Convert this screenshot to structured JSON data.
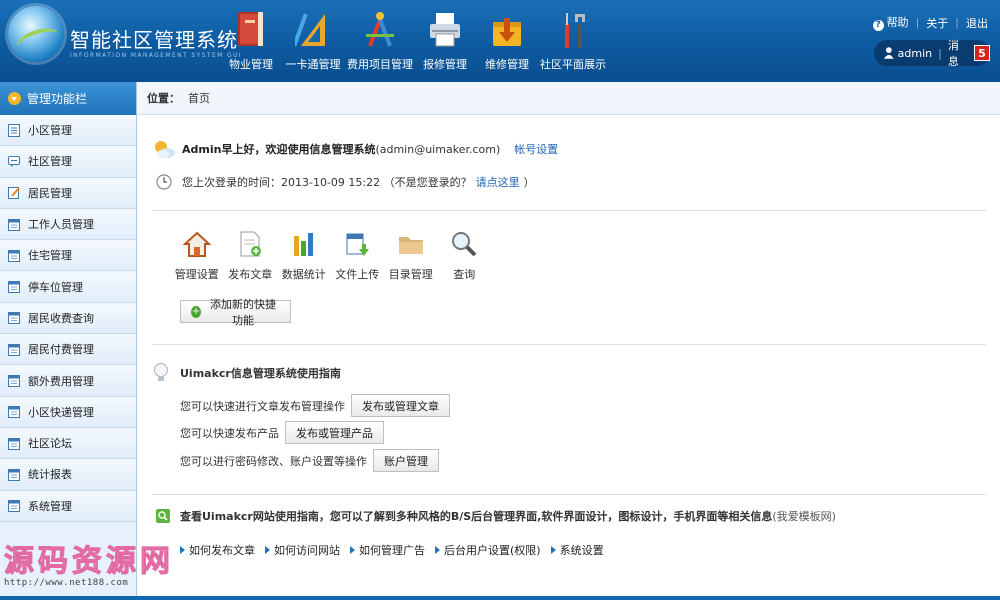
{
  "header": {
    "title": "智能社区管理系统",
    "subtitle": "INFORMATION MANAGEMENT SYSTEM GUI",
    "nav": [
      {
        "label": "物业管理",
        "icon": "book-icon"
      },
      {
        "label": "一卡通管理",
        "icon": "ruler-icon"
      },
      {
        "label": "费用项目管理",
        "icon": "drafting-tools-icon"
      },
      {
        "label": "报修管理",
        "icon": "printer-icon"
      },
      {
        "label": "维修管理",
        "icon": "download-box-icon"
      },
      {
        "label": "社区平面展示",
        "icon": "tools-icon"
      }
    ],
    "links": {
      "help": "帮助",
      "about": "关于",
      "logout": "退出"
    },
    "user": {
      "name": "admin",
      "messages_label": "消息",
      "messages_count": "5"
    }
  },
  "sidebar": {
    "title": "管理功能栏",
    "items": [
      {
        "label": "小区管理"
      },
      {
        "label": "社区管理"
      },
      {
        "label": "居民管理"
      },
      {
        "label": "工作人员管理"
      },
      {
        "label": "住宅管理"
      },
      {
        "label": "停车位管理"
      },
      {
        "label": "居民收费查询"
      },
      {
        "label": "居民付费管理"
      },
      {
        "label": "额外费用管理"
      },
      {
        "label": "小区快递管理"
      },
      {
        "label": "社区论坛"
      },
      {
        "label": "统计报表"
      },
      {
        "label": "系统管理"
      }
    ]
  },
  "breadcrumb": {
    "label": "位置：",
    "current": "首页"
  },
  "welcome": {
    "greeting": "Admin早上好，欢迎使用信息管理系统",
    "email": "(admin@uimaker.com)",
    "account_link": "帐号设置",
    "last_login_text": "您上次登录的时间：2013-10-09 15:22 （不是您登录的？",
    "last_login_link": "请点这里",
    "last_login_close": "）"
  },
  "quick": {
    "items": [
      {
        "label": "管理设置",
        "icon": "house-icon"
      },
      {
        "label": "发布文章",
        "icon": "document-add-icon"
      },
      {
        "label": "数据统计",
        "icon": "bar-chart-icon"
      },
      {
        "label": "文件上传",
        "icon": "file-upload-icon"
      },
      {
        "label": "目录管理",
        "icon": "folder-icon"
      },
      {
        "label": "查询",
        "icon": "magnifier-icon"
      }
    ],
    "add_label": "添加新的快捷功能"
  },
  "guide": {
    "title": "Uimakcr信息管理系统使用指南",
    "rows": [
      {
        "text": "您可以快速进行文章发布管理操作",
        "button": "发布或管理文章"
      },
      {
        "text": "您可以快速发布产品",
        "button": "发布或管理产品"
      },
      {
        "text": "您可以进行密码修改、账户设置等操作",
        "button": "账户管理"
      }
    ]
  },
  "site": {
    "title": "查看Uimakcr网站使用指南，您可以了解到多种风格的B/S后台管理界面,软件界面设计，图标设计，手机界面等相关信息",
    "title_suffix": "(我爱模板网)",
    "links": [
      "如何发布文章",
      "如何访问网站",
      "如何管理广告",
      "后台用户设置(权限)",
      "系统设置"
    ]
  },
  "watermark": {
    "title": "源码资源网",
    "url": "http://www.net188.com"
  }
}
